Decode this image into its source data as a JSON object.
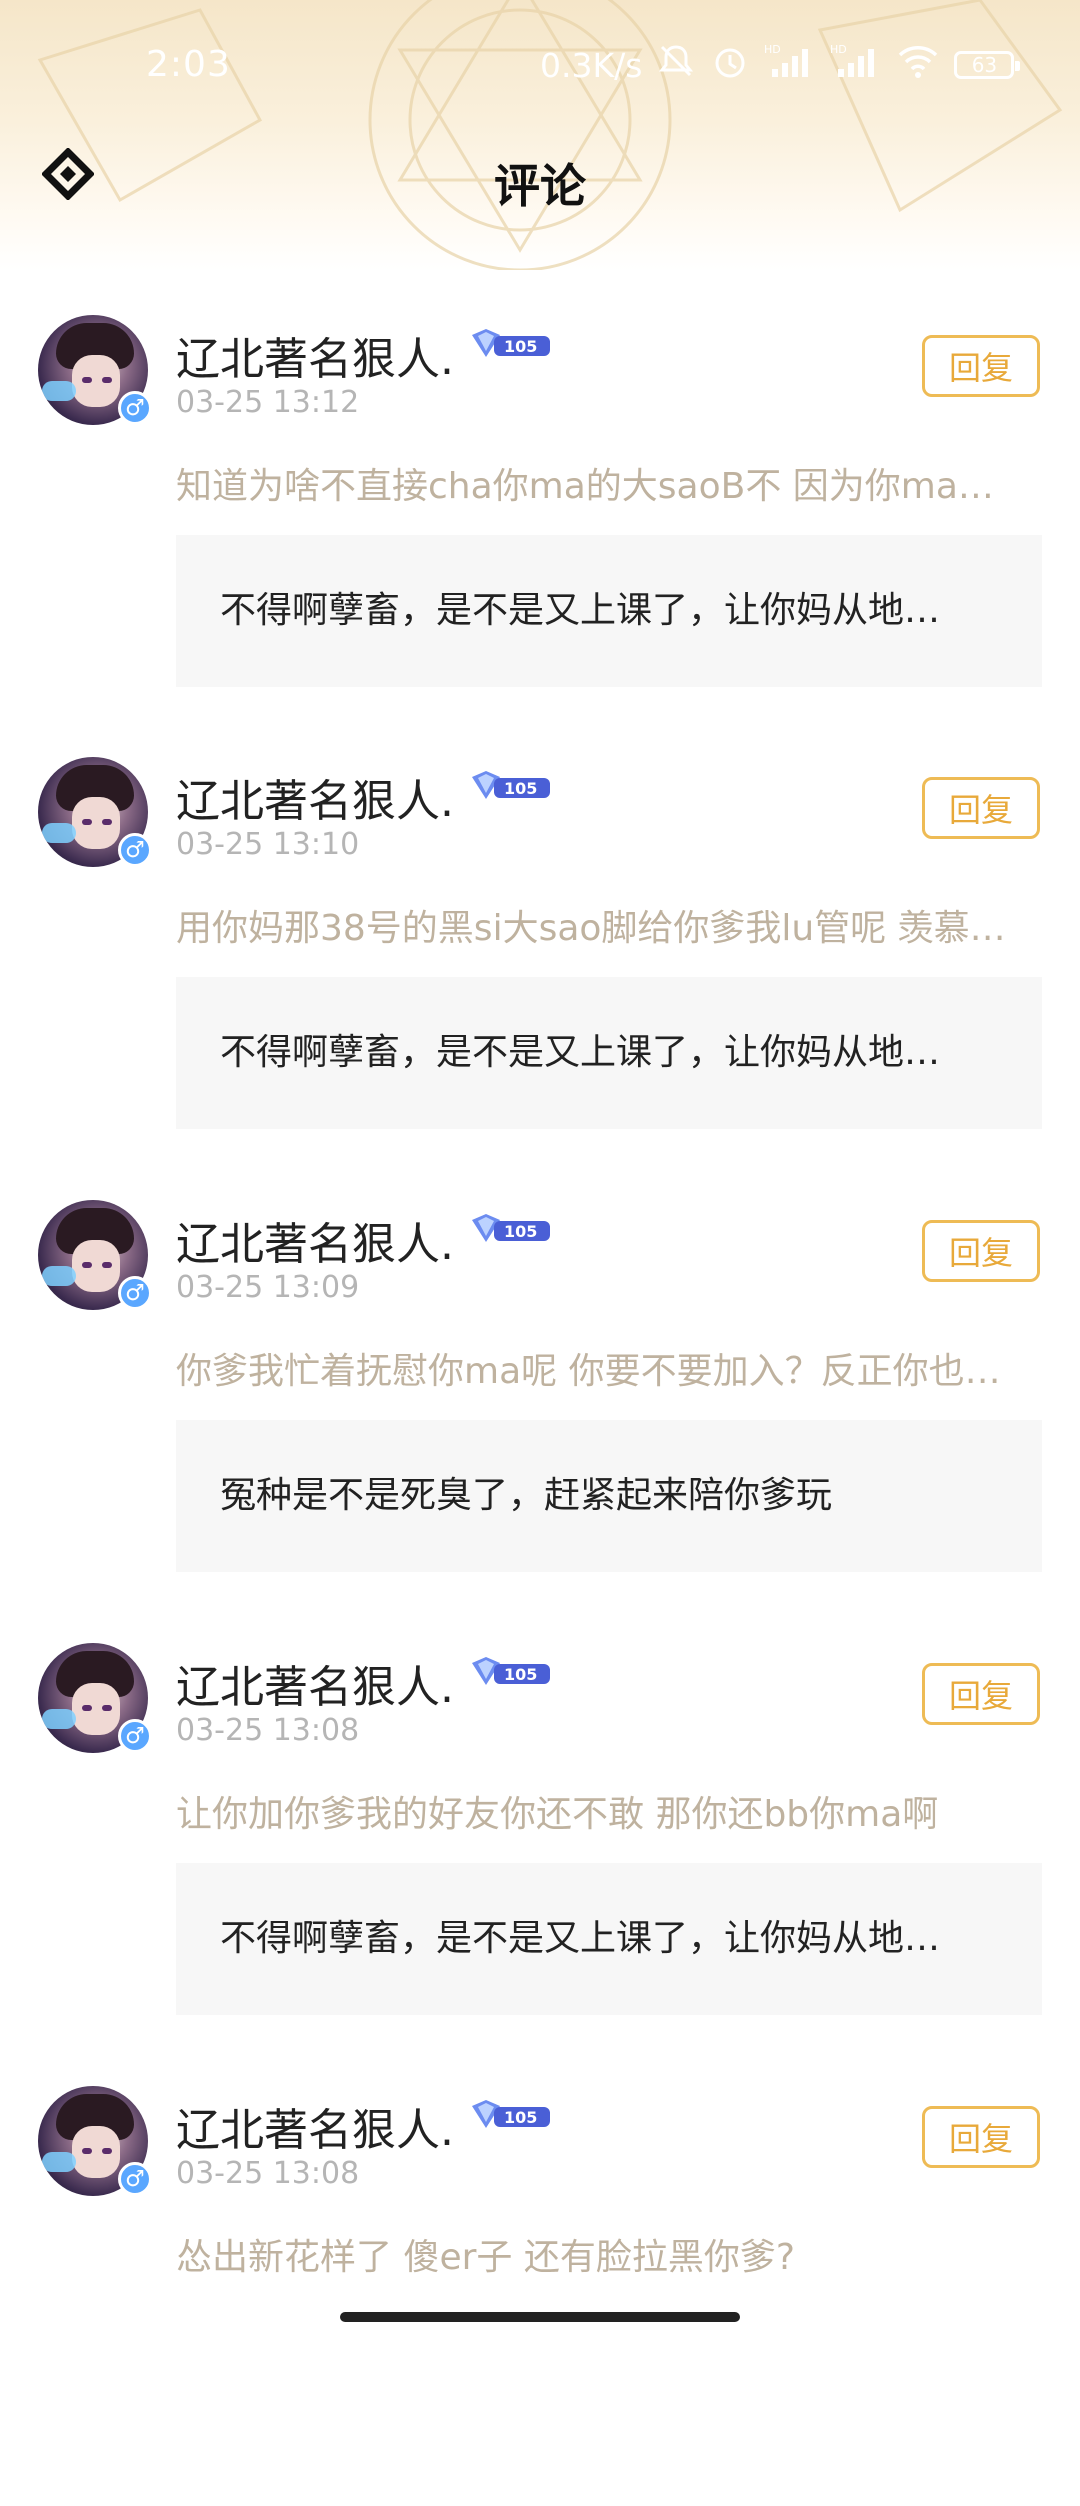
{
  "status_bar": {
    "time": "2:03",
    "net_speed": "0.3K/s",
    "battery": "63",
    "icons": [
      "mute-bell-icon",
      "alarm-icon",
      "signal-hd-icon",
      "signal-hd-icon",
      "wifi-icon",
      "battery-icon"
    ]
  },
  "header": {
    "title": "评论",
    "back_icon": "diamond-back-icon"
  },
  "comments": [
    {
      "username": "辽北著名狠人.",
      "time": "03-25 13:12",
      "level": "105",
      "reply_label": "回复",
      "text": "知道为啥不直接cha你ma的大saoB不 因为你ma…",
      "quote": "不得啊孽畜，是不是又上课了，让你妈从地…"
    },
    {
      "username": "辽北著名狠人.",
      "time": "03-25 13:10",
      "level": "105",
      "reply_label": "回复",
      "text": "用你妈那38号的黑si大sao脚给你爹我lu管呢 羡慕…",
      "quote": "不得啊孽畜，是不是又上课了，让你妈从地…"
    },
    {
      "username": "辽北著名狠人.",
      "time": "03-25 13:09",
      "level": "105",
      "reply_label": "回复",
      "text": "你爹我忙着抚慰你ma呢 你要不要加入？反正你也…",
      "quote": "冤种是不是死臭了，赶紧起来陪你爹玩"
    },
    {
      "username": "辽北著名狠人.",
      "time": "03-25 13:08",
      "level": "105",
      "reply_label": "回复",
      "text": "让你加你爹我的好友你还不敢 那你还bb你ma啊",
      "quote": "不得啊孽畜，是不是又上课了，让你妈从地…"
    },
    {
      "username": "辽北著名狠人.",
      "time": "03-25 13:08",
      "level": "105",
      "reply_label": "回复",
      "text": "怂出新花样了 傻er子 还有脸拉黑你爹?",
      "quote": ""
    }
  ]
}
